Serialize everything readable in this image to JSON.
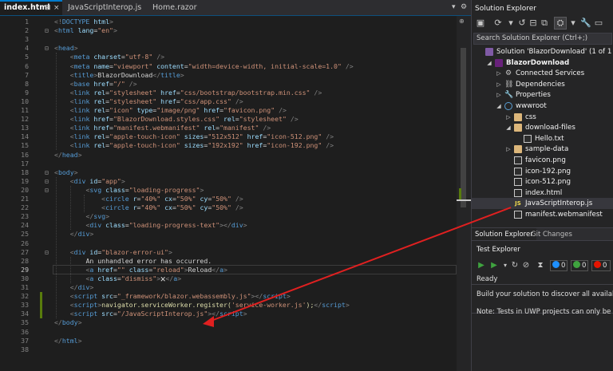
{
  "tabs": [
    {
      "label": "index.html",
      "active": true
    },
    {
      "label": "JavaScriptInterop.js",
      "active": false
    },
    {
      "label": "Home.razor",
      "active": false
    }
  ],
  "tab_controls": {
    "pin": "⊞",
    "close": "×"
  },
  "editor": {
    "current_line": 29,
    "lines": [
      {
        "n": "1",
        "html": "<span class='t-tag'>&lt;!</span><span class='t-name'>DOCTYPE</span> <span class='t-attr'>html</span><span class='t-tag'>&gt;</span>"
      },
      {
        "n": "2",
        "html": "<span class='t-tag'>&lt;</span><span class='t-name'>html</span> <span class='t-attr'>lang</span><span class='t-text'>=</span><span class='t-str'>\"en\"</span><span class='t-tag'>&gt;</span>"
      },
      {
        "n": "3",
        "html": ""
      },
      {
        "n": "4",
        "html": "<span class='t-tag'>&lt;</span><span class='t-name'>head</span><span class='t-tag'>&gt;</span>"
      },
      {
        "n": "5",
        "html": "    <span class='t-tag'>&lt;</span><span class='t-name'>meta</span> <span class='t-attr'>charset</span><span class='t-text'>=</span><span class='t-str'>\"utf-8\"</span> <span class='t-tag'>/&gt;</span>"
      },
      {
        "n": "6",
        "html": "    <span class='t-tag'>&lt;</span><span class='t-name'>meta</span> <span class='t-attr'>name</span><span class='t-text'>=</span><span class='t-str'>\"viewport\"</span> <span class='t-attr'>content</span><span class='t-text'>=</span><span class='t-str'>\"width=device-width, initial-scale=1.0\"</span> <span class='t-tag'>/&gt;</span>"
      },
      {
        "n": "7",
        "html": "    <span class='t-tag'>&lt;</span><span class='t-name'>title</span><span class='t-tag'>&gt;</span><span class='t-text'>BlazorDownload</span><span class='t-tag'>&lt;/</span><span class='t-name'>title</span><span class='t-tag'>&gt;</span>"
      },
      {
        "n": "8",
        "html": "    <span class='t-tag'>&lt;</span><span class='t-name'>base</span> <span class='t-attr'>href</span><span class='t-text'>=</span><span class='t-str'>\"/\"</span> <span class='t-tag'>/&gt;</span>"
      },
      {
        "n": "9",
        "html": "    <span class='t-tag'>&lt;</span><span class='t-name'>link</span> <span class='t-attr'>rel</span><span class='t-text'>=</span><span class='t-str'>\"stylesheet\"</span> <span class='t-attr'>href</span><span class='t-text'>=</span><span class='t-str'>\"css/bootstrap/bootstrap.min.css\"</span> <span class='t-tag'>/&gt;</span>"
      },
      {
        "n": "10",
        "html": "    <span class='t-tag'>&lt;</span><span class='t-name'>link</span> <span class='t-attr'>rel</span><span class='t-text'>=</span><span class='t-str'>\"stylesheet\"</span> <span class='t-attr'>href</span><span class='t-text'>=</span><span class='t-str'>\"css/app.css\"</span> <span class='t-tag'>/&gt;</span>"
      },
      {
        "n": "11",
        "html": "    <span class='t-tag'>&lt;</span><span class='t-name'>link</span> <span class='t-attr'>rel</span><span class='t-text'>=</span><span class='t-str'>\"icon\"</span> <span class='t-attr'>type</span><span class='t-text'>=</span><span class='t-str'>\"image/png\"</span> <span class='t-attr'>href</span><span class='t-text'>=</span><span class='t-str'>\"favicon.png\"</span> <span class='t-tag'>/&gt;</span>"
      },
      {
        "n": "12",
        "html": "    <span class='t-tag'>&lt;</span><span class='t-name'>link</span> <span class='t-attr'>href</span><span class='t-text'>=</span><span class='t-str'>\"BlazorDownload.styles.css\"</span> <span class='t-attr'>rel</span><span class='t-text'>=</span><span class='t-str'>\"stylesheet\"</span> <span class='t-tag'>/&gt;</span>"
      },
      {
        "n": "13",
        "html": "    <span class='t-tag'>&lt;</span><span class='t-name'>link</span> <span class='t-attr'>href</span><span class='t-text'>=</span><span class='t-str'>\"manifest.webmanifest\"</span> <span class='t-attr'>rel</span><span class='t-text'>=</span><span class='t-str'>\"manifest\"</span> <span class='t-tag'>/&gt;</span>"
      },
      {
        "n": "14",
        "html": "    <span class='t-tag'>&lt;</span><span class='t-name'>link</span> <span class='t-attr'>rel</span><span class='t-text'>=</span><span class='t-str'>\"apple-touch-icon\"</span> <span class='t-attr'>sizes</span><span class='t-text'>=</span><span class='t-str'>\"512x512\"</span> <span class='t-attr'>href</span><span class='t-text'>=</span><span class='t-str'>\"icon-512.png\"</span> <span class='t-tag'>/&gt;</span>"
      },
      {
        "n": "15",
        "html": "    <span class='t-tag'>&lt;</span><span class='t-name'>link</span> <span class='t-attr'>rel</span><span class='t-text'>=</span><span class='t-str'>\"apple-touch-icon\"</span> <span class='t-attr'>sizes</span><span class='t-text'>=</span><span class='t-str'>\"192x192\"</span> <span class='t-attr'>href</span><span class='t-text'>=</span><span class='t-str'>\"icon-192.png\"</span> <span class='t-tag'>/&gt;</span>"
      },
      {
        "n": "16",
        "html": "<span class='t-tag'>&lt;/</span><span class='t-name'>head</span><span class='t-tag'>&gt;</span>"
      },
      {
        "n": "17",
        "html": ""
      },
      {
        "n": "18",
        "html": "<span class='t-tag'>&lt;</span><span class='t-name'>body</span><span class='t-tag'>&gt;</span>"
      },
      {
        "n": "19",
        "html": "    <span class='t-tag'>&lt;</span><span class='t-name'>div</span> <span class='t-attr'>id</span><span class='t-text'>=</span><span class='t-str'>\"app\"</span><span class='t-tag'>&gt;</span>"
      },
      {
        "n": "20",
        "html": "        <span class='t-tag'>&lt;</span><span class='t-name'>svg</span> <span class='t-attr'>class</span><span class='t-text'>=</span><span class='t-str'>\"loading-progress\"</span><span class='t-tag'>&gt;</span>"
      },
      {
        "n": "21",
        "html": "            <span class='t-tag'>&lt;</span><span class='t-name'>circle</span> <span class='t-attr'>r</span><span class='t-text'>=</span><span class='t-str'>\"40%\"</span> <span class='t-attr'>cx</span><span class='t-text'>=</span><span class='t-str'>\"50%\"</span> <span class='t-attr'>cy</span><span class='t-text'>=</span><span class='t-str'>\"50%\"</span> <span class='t-tag'>/&gt;</span>"
      },
      {
        "n": "22",
        "html": "            <span class='t-tag'>&lt;</span><span class='t-name'>circle</span> <span class='t-attr'>r</span><span class='t-text'>=</span><span class='t-str'>\"40%\"</span> <span class='t-attr'>cx</span><span class='t-text'>=</span><span class='t-str'>\"50%\"</span> <span class='t-attr'>cy</span><span class='t-text'>=</span><span class='t-str'>\"50%\"</span> <span class='t-tag'>/&gt;</span>"
      },
      {
        "n": "23",
        "html": "        <span class='t-tag'>&lt;/</span><span class='t-name'>svg</span><span class='t-tag'>&gt;</span>"
      },
      {
        "n": "24",
        "html": "        <span class='t-tag'>&lt;</span><span class='t-name'>div</span> <span class='t-attr'>class</span><span class='t-text'>=</span><span class='t-str'>\"loading-progress-text\"</span><span class='t-tag'>&gt;&lt;/</span><span class='t-name'>div</span><span class='t-tag'>&gt;</span>"
      },
      {
        "n": "25",
        "html": "    <span class='t-tag'>&lt;/</span><span class='t-name'>div</span><span class='t-tag'>&gt;</span>"
      },
      {
        "n": "26",
        "html": ""
      },
      {
        "n": "27",
        "html": "    <span class='t-tag'>&lt;</span><span class='t-name'>div</span> <span class='t-attr'>id</span><span class='t-text'>=</span><span class='t-str'>\"blazor-error-ui\"</span><span class='t-tag'>&gt;</span>"
      },
      {
        "n": "28",
        "html": "        <span class='t-text'>An unhandled error has occurred.</span>"
      },
      {
        "n": "29",
        "html": "        <span class='t-tag'>&lt;</span><span class='t-name'>a</span> <span class='t-attr'>href</span><span class='t-text'>=</span><span class='t-str'>\"\"</span> <span class='t-attr'>class</span><span class='t-text'>=</span><span class='t-str'>\"reload\"</span><span class='t-tag'>&gt;</span><span class='t-text'>Reload</span><span class='t-tag'>&lt;/</span><span class='t-name'>a</span><span class='t-tag'>&gt;</span>"
      },
      {
        "n": "30",
        "html": "        <span class='t-tag'>&lt;</span><span class='t-name'>a</span> <span class='t-attr'>class</span><span class='t-text'>=</span><span class='t-str'>\"dismiss\"</span><span class='t-tag'>&gt;</span><span class='t-text'>🗙</span><span class='t-tag'>&lt;/</span><span class='t-name'>a</span><span class='t-tag'>&gt;</span>"
      },
      {
        "n": "31",
        "html": "    <span class='t-tag'>&lt;/</span><span class='t-name'>div</span><span class='t-tag'>&gt;</span>"
      },
      {
        "n": "32",
        "html": "    <span class='t-tag'>&lt;</span><span class='t-name'>script</span> <span class='t-attr'>src</span><span class='t-text'>=</span><span class='t-str'>\"_framework/blazor.webassembly.js\"</span><span class='t-tag'>&gt;&lt;/</span><span class='t-name'>script</span><span class='t-tag'>&gt;</span>"
      },
      {
        "n": "33",
        "html": "    <span class='t-tag'>&lt;</span><span class='t-name'>script</span><span class='t-tag'>&gt;</span><span class='t-js'>navigator.serviceWorker.register(</span><span class='t-str'>'service-worker.js'</span><span class='t-js'>);</span><span class='t-tag'>&lt;/</span><span class='t-name'>script</span><span class='t-tag'>&gt;</span>"
      },
      {
        "n": "34",
        "html": "    <span class='t-tag'>&lt;</span><span class='t-name'>script</span> <span class='t-attr'>src</span><span class='t-text'>=</span><span class='t-str'>\"/JavaScriptInterop.js\"</span><span class='t-tag'>&gt;&lt;/</span><span class='t-name'>script</span><span class='t-tag'>&gt;</span>"
      },
      {
        "n": "35",
        "html": "<span class='t-tag'>&lt;/</span><span class='t-name'>body</span><span class='t-tag'>&gt;</span>"
      },
      {
        "n": "36",
        "html": ""
      },
      {
        "n": "37",
        "html": "<span class='t-tag'>&lt;/</span><span class='t-name'>html</span><span class='t-tag'>&gt;</span>"
      },
      {
        "n": "38",
        "html": ""
      }
    ]
  },
  "solution_explorer": {
    "title": "Solution Explorer",
    "search_placeholder": "Search Solution Explorer (Ctrl+;)",
    "items": [
      {
        "label": "Solution 'BlazorDownload' (1 of 1 project)",
        "icon": "solution-icon",
        "indent": 0,
        "arrow": ""
      },
      {
        "label": "BlazorDownload",
        "icon": "project-icon",
        "indent": 1,
        "arrow": "◢",
        "bold": true
      },
      {
        "label": "Connected Services",
        "icon": "connected-services-icon",
        "indent": 2,
        "arrow": "▷"
      },
      {
        "label": "Dependencies",
        "icon": "dependencies-icon",
        "indent": 2,
        "arrow": "▷"
      },
      {
        "label": "Properties",
        "icon": "properties-icon",
        "indent": 2,
        "arrow": "▷"
      },
      {
        "label": "wwwroot",
        "icon": "globe-icon",
        "indent": 2,
        "arrow": "◢"
      },
      {
        "label": "css",
        "icon": "folder-icon",
        "indent": 3,
        "arrow": "▷"
      },
      {
        "label": "download-files",
        "icon": "folder-icon",
        "indent": 3,
        "arrow": "◢"
      },
      {
        "label": "Hello.txt",
        "icon": "file-icon",
        "indent": 4,
        "arrow": ""
      },
      {
        "label": "sample-data",
        "icon": "folder-icon",
        "indent": 3,
        "arrow": "▷"
      },
      {
        "label": "favicon.png",
        "icon": "image-file-icon",
        "indent": 3,
        "arrow": ""
      },
      {
        "label": "icon-192.png",
        "icon": "image-file-icon",
        "indent": 3,
        "arrow": ""
      },
      {
        "label": "icon-512.png",
        "icon": "image-file-icon",
        "indent": 3,
        "arrow": ""
      },
      {
        "label": "index.html",
        "icon": "html-file-icon",
        "indent": 3,
        "arrow": ""
      },
      {
        "label": "JavaScriptInterop.js",
        "icon": "js-file-icon",
        "indent": 3,
        "arrow": "",
        "selected": true
      },
      {
        "label": "manifest.webmanifest",
        "icon": "file-icon",
        "indent": 3,
        "arrow": ""
      }
    ],
    "bottom_tabs": [
      "Solution Explorer",
      "Git Changes"
    ]
  },
  "test_explorer": {
    "title": "Test Explorer",
    "counts": [
      "0",
      "0",
      "0"
    ],
    "status": "Ready",
    "message_1": "Build your solution to discover all available tes",
    "message_2": "Note: Tests in UWP projects can only be discov"
  },
  "colors": {
    "accent": "#007acc",
    "annotation_arrow": "#e02020",
    "added_line_marker": "#587c0c",
    "pass_green": "#3fa33f",
    "fail_red": "#e51400",
    "neutral_blue": "#1e90ff"
  }
}
